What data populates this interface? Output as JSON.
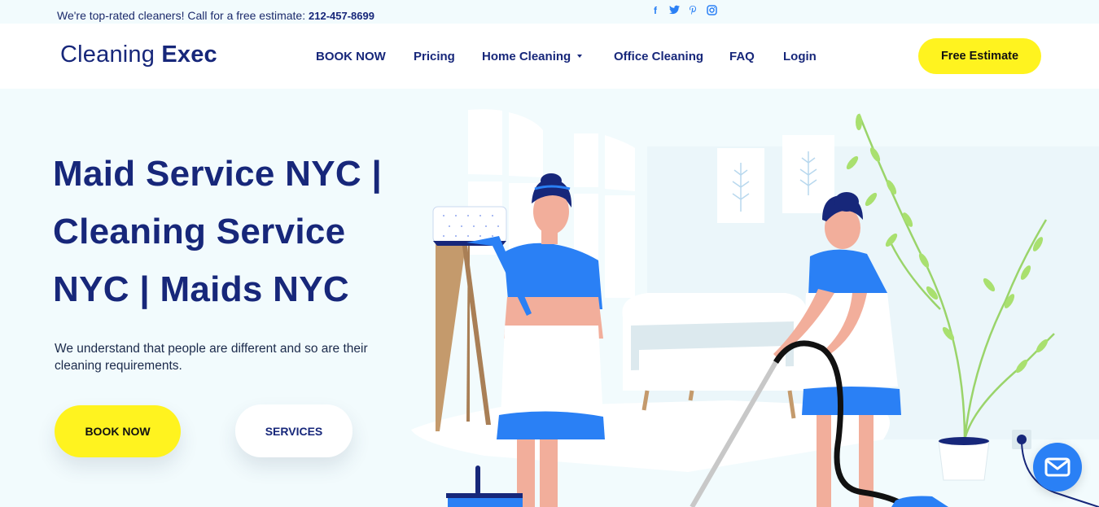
{
  "topbar": {
    "tagline": "We're top-rated cleaners! Call for a free estimate:",
    "phone": "212-457-8699",
    "social": [
      {
        "name": "facebook-icon",
        "glyph": "f"
      },
      {
        "name": "twitter-icon",
        "glyph": "t"
      },
      {
        "name": "pinterest-icon",
        "glyph": "p"
      },
      {
        "name": "instagram-icon",
        "glyph": "◎"
      }
    ]
  },
  "header": {
    "logo_light": "Cleaning",
    "logo_bold": "Exec",
    "nav": [
      {
        "label": "BOOK NOW"
      },
      {
        "label": "Pricing"
      },
      {
        "label": "Home Cleaning",
        "has_dropdown": true
      },
      {
        "label": "Office Cleaning"
      },
      {
        "label": "FAQ"
      },
      {
        "label": "Login"
      }
    ],
    "cta": "Free Estimate"
  },
  "hero": {
    "title_lines": [
      "Maid Service NYC |",
      "Cleaning Service",
      "NYC | Maids NYC"
    ],
    "subtitle": "We understand that people are different and so are their cleaning requirements.",
    "primary_button": "BOOK NOW",
    "secondary_button": "SERVICES"
  },
  "colors": {
    "brand_navy": "#17277a",
    "accent_yellow": "#fff31f",
    "accent_blue": "#2a80f5",
    "background": "#f2fbfd"
  },
  "chat": {
    "icon": "mail-icon"
  }
}
